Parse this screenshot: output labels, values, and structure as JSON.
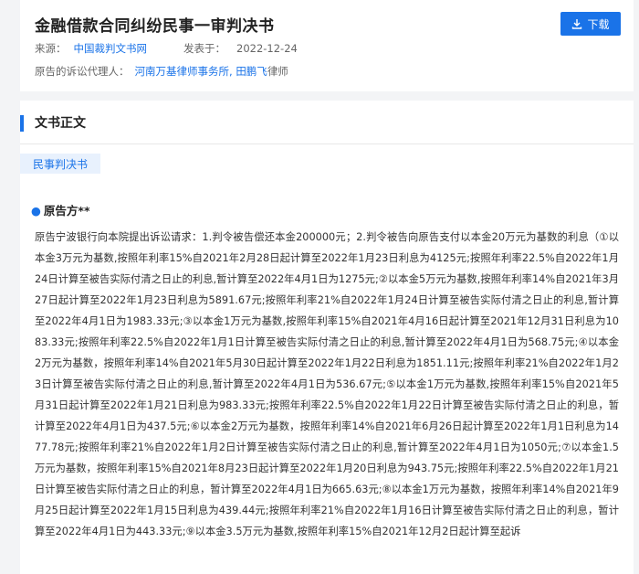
{
  "header": {
    "title": "金融借款合同纠纷民事一审判决书",
    "download_label": "下载",
    "source_label": "来源：",
    "source_value": "中国裁判文书网",
    "publish_label": "发表于：",
    "publish_date": "2022-12-24",
    "agent_label": "原告的诉讼代理人：",
    "agent_firm": "河南万基律师事务所",
    "agent_sep": ", ",
    "agent_name": "田鹏飞",
    "agent_suffix": "律师"
  },
  "section": {
    "heading": "文书正文",
    "doc_type_tag": "民事判决书",
    "party_heading": "原告方**"
  },
  "body": {
    "paragraph": "原告宁波银行向本院提出诉讼请求：1.判令被告偿还本金200000元；2.判令被告向原告支付以本金20万元为基数的利息（①以本金3万元为基数,按照年利率15%自2021年2月28日起计算至2022年1月23日利息为4125元;按照年利率22.5%自2022年1月24日计算至被告实际付清之日止的利息,暂计算至2022年4月1日为1275元;②以本金5万元为基数,按照年利率14%自2021年3月27日起计算至2022年1月23日利息为5891.67元;按照年利率21%自2022年1月24日计算至被告实际付清之日止的利息,暂计算至2022年4月1日为1983.33元;③以本金1万元为基数,按照年利率15%自2021年4月16日起计算至2021年12月31日利息为1083.33元;按照年利率22.5%自2022年1月1日计算至被告实际付清之日止的利息,暂计算至2022年4月1日为568.75元;④以本金2万元为基数，按照年利率14%自2021年5月30日起计算至2022年1月22日利息为1851.11元;按照年利率21%自2022年1月23日计算至被告实际付清之日止的利息,暂计算至2022年4月1日为536.67元;⑤以本金1万元为基数,按照年利率15%自2021年5月31日起计算至2022年1月21日利息为983.33元;按照年利率22.5%自2022年1月22日计算至被告实际付清之日止的利息，暂计算至2022年4月1日为437.5元;⑥以本金2万元为基数，按照年利率14%自2021年6月26日起计算至2022年1月1日利息为1477.78元;按照年利率21%自2022年1月2日计算至被告实际付清之日止的利息,暂计算至2022年4月1日为1050元;⑦以本金1.5万元为基数，按照年利率15%自2021年8月23日起计算至2022年1月20日利息为943.75元;按照年利率22.5%自2022年1月21日计算至被告实际付清之日止的利息，暂计算至2022年4月1日为665.63元;⑧以本金1万元为基数，按照年利率14%自2021年9月25日起计算至2022年1月15日利息为439.44元;按照年利率21%自2022年1月16日计算至被告实际付清之日止的利息，暂计算至2022年4月1日为443.33元;⑨以本金3.5万元为基数,按照年利率15%自2021年12月2日起计算至起诉"
  },
  "colors": {
    "accent": "#1a73e8",
    "tag_bg": "#e8f1fd",
    "page_bg": "#f3f4f6"
  },
  "icons": {
    "download": "download-icon"
  }
}
